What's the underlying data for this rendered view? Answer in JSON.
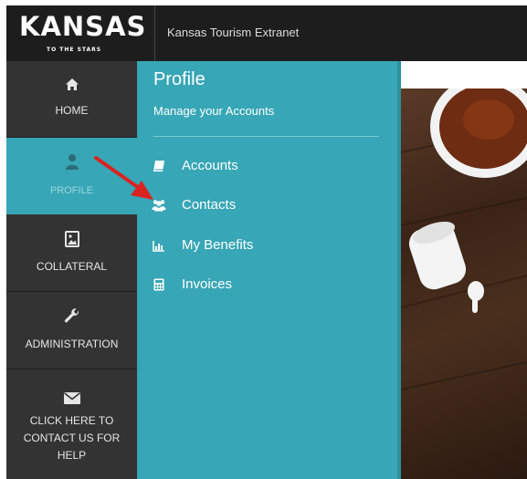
{
  "header": {
    "logo_word": "KANSAS",
    "logo_tagline": "TO THE STARS",
    "site_title": "Kansas Tourism Extranet"
  },
  "sidebar": {
    "items": [
      {
        "label": "HOME",
        "icon": "home-icon"
      },
      {
        "label": "PROFILE",
        "icon": "user-icon",
        "active": true
      },
      {
        "label": "COLLATERAL",
        "icon": "image-file-icon"
      },
      {
        "label": "ADMINISTRATION",
        "icon": "wrench-icon"
      },
      {
        "label": "CLICK HERE TO CONTACT US FOR HELP",
        "icon": "envelope-icon"
      }
    ]
  },
  "panel": {
    "title": "Profile",
    "subtitle": "Manage your Accounts",
    "items": [
      {
        "label": "Accounts",
        "icon": "book-icon"
      },
      {
        "label": "Contacts",
        "icon": "users-icon"
      },
      {
        "label": "My Benefits",
        "icon": "bar-chart-icon"
      },
      {
        "label": "Invoices",
        "icon": "calculator-icon"
      }
    ]
  },
  "annotation": {
    "type": "red-arrow",
    "color": "#d9231f",
    "points_to": "Contacts"
  },
  "colors": {
    "header_bg": "#1d1d1d",
    "sidebar_bg": "#333333",
    "accent": "#37a6b6",
    "white": "#ffffff"
  }
}
